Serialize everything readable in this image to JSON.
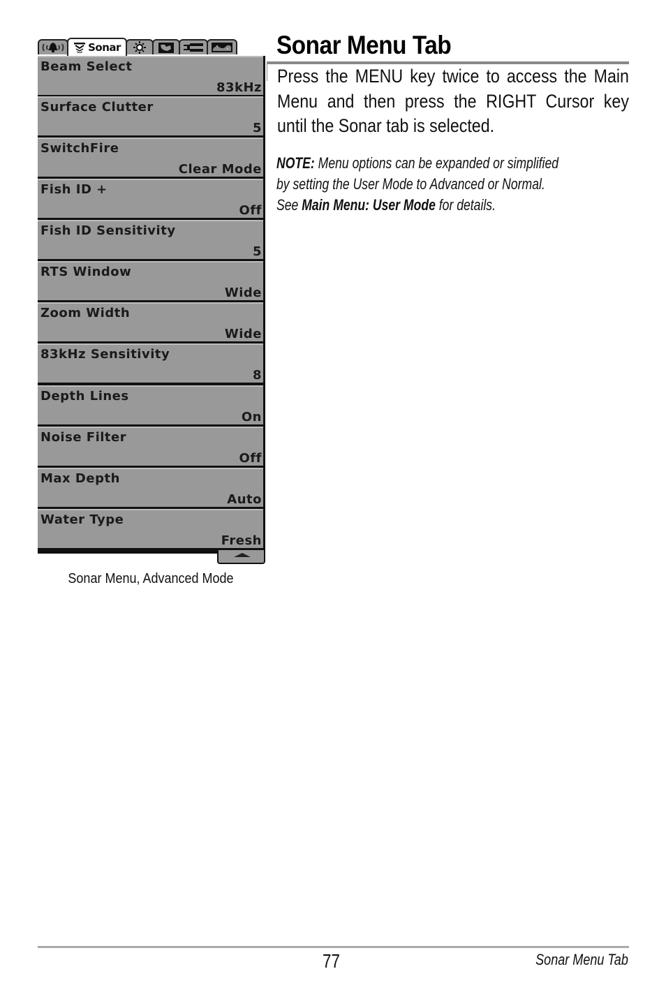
{
  "device_menu": {
    "tabs": [
      {
        "icon": "alarm-bell-icon",
        "label": "",
        "active": false
      },
      {
        "icon": "sonar-icon",
        "label": "Sonar",
        "active": true
      },
      {
        "icon": "display-brightness-icon",
        "label": "",
        "active": false
      },
      {
        "icon": "navigation-map-icon",
        "label": "",
        "active": false
      },
      {
        "icon": "setup-wrench-icon",
        "label": "",
        "active": false
      },
      {
        "icon": "views-icon",
        "label": "",
        "active": false
      }
    ],
    "items": [
      {
        "name": "Beam Select",
        "value": "83kHz"
      },
      {
        "name": "Surface Clutter",
        "value": "5"
      },
      {
        "name": "SwitchFire",
        "value": "Clear Mode"
      },
      {
        "name": "Fish ID +",
        "value": "Off"
      },
      {
        "name": "Fish ID Sensitivity",
        "value": "5"
      },
      {
        "name": "RTS Window",
        "value": "Wide"
      },
      {
        "name": "Zoom Width",
        "value": "Wide"
      },
      {
        "name": "83kHz Sensitivity",
        "value": "8"
      },
      {
        "name": "Depth Lines",
        "value": "On"
      },
      {
        "name": "Noise Filter",
        "value": "Off"
      },
      {
        "name": "Max Depth",
        "value": "Auto"
      },
      {
        "name": "Water Type",
        "value": "Fresh"
      }
    ],
    "scroll_indicator": "scroll-up-arrow",
    "colors": {
      "item_bg": "#999999",
      "active_tab_bg": "#ffffff",
      "border": "#111111"
    }
  },
  "figure_caption": "Sonar Menu, Advanced Mode",
  "section": {
    "title": "Sonar Menu Tab",
    "intro_lines": [
      "Press the MENU key twice to access the Main",
      "Menu and then press the RIGHT Cursor key",
      "until the Sonar tab is selected."
    ],
    "note": {
      "label": "NOTE:",
      "line1_rest": " Menu options can be expanded or simplified",
      "line2": "by setting the User Mode to Advanced or Normal.",
      "line3_pre": "See ",
      "line3_bold": "Main Menu: User Mode",
      "line3_post": " for details."
    }
  },
  "footer": {
    "page_number": "77",
    "running_title": "Sonar Menu Tab"
  }
}
